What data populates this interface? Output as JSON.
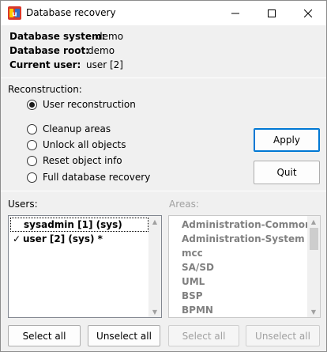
{
  "window": {
    "title": "Database recovery"
  },
  "info": {
    "system_label": "Database system:",
    "system_value": "demo",
    "root_label": "Database root:",
    "root_value": "demo",
    "user_label": "Current user:",
    "user_value": "user [2]"
  },
  "reconstruction": {
    "label": "Reconstruction:",
    "options": [
      {
        "label": "User reconstruction",
        "selected": true
      },
      {
        "label": "Cleanup areas",
        "selected": false
      },
      {
        "label": "Unlock all objects",
        "selected": false
      },
      {
        "label": "Reset object info",
        "selected": false
      },
      {
        "label": "Full database recovery",
        "selected": false
      }
    ]
  },
  "buttons": {
    "apply": "Apply",
    "quit": "Quit"
  },
  "users": {
    "label": "Users:",
    "items": [
      {
        "label": "sysadmin [1]  (sys)",
        "checked": false
      },
      {
        "label": "user [2]  (sys) *",
        "checked": true
      }
    ],
    "select_all": "Select all",
    "unselect_all": "Unselect all"
  },
  "areas": {
    "label": "Areas:",
    "items": [
      "Administration-Common",
      "Administration-System",
      "mcc",
      "SA/SD",
      "UML",
      "BSP",
      "BPMN"
    ],
    "select_all": "Select all",
    "unselect_all": "Unselect all"
  },
  "colors": {
    "accent": "#0078d4",
    "disabled_text": "#a0a0a0",
    "list_border": "#828790"
  }
}
